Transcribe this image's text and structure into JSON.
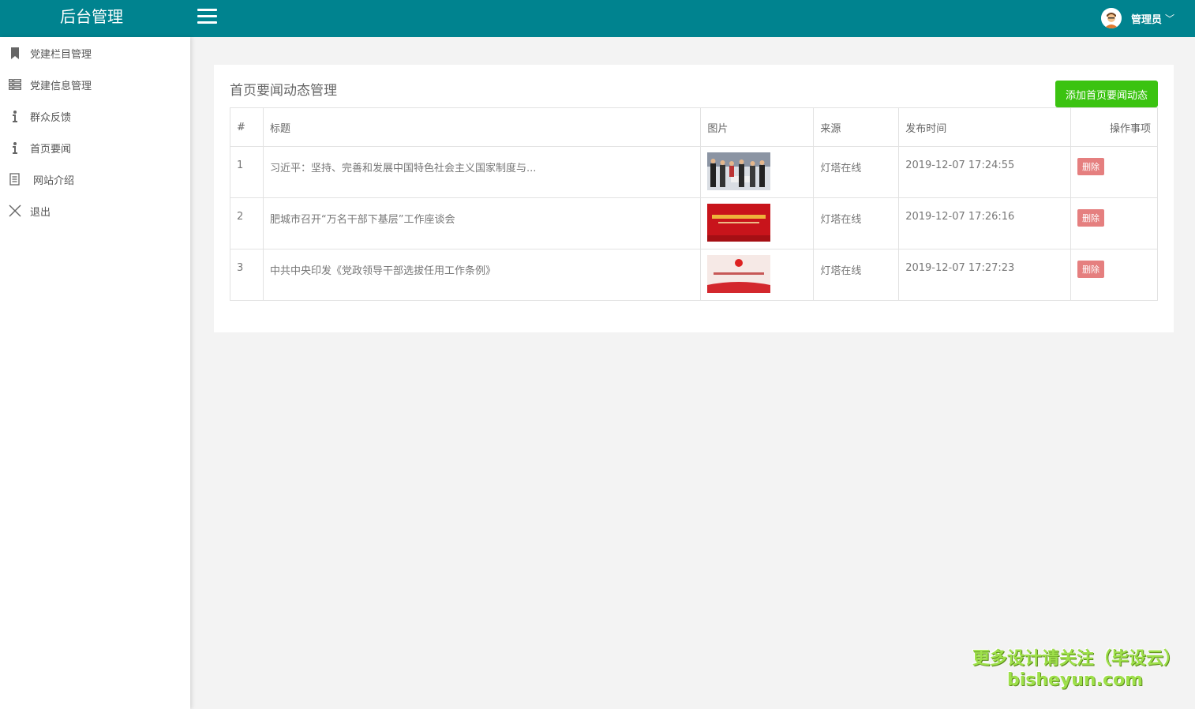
{
  "header": {
    "brand": "后台管理",
    "user_name": "管理员",
    "caret": "﹀"
  },
  "sidebar": {
    "items": [
      {
        "label": "党建栏目管理",
        "icon": "bookmark-icon"
      },
      {
        "label": "党建信息管理",
        "icon": "list-icon"
      },
      {
        "label": "群众反馈",
        "icon": "info-icon"
      },
      {
        "label": "首页要闻",
        "icon": "info-icon"
      },
      {
        "label": "网站介绍",
        "icon": "document-icon"
      },
      {
        "label": "退出",
        "icon": "close-icon"
      }
    ]
  },
  "main": {
    "title": "首页要闻动态管理",
    "add_label": "添加首页要闻动态",
    "columns": [
      "#",
      "标题",
      "图片",
      "来源",
      "发布时间",
      "操作事项"
    ],
    "rows": [
      {
        "num": "1",
        "title": "习近平：坚持、完善和发展中国特色社会主义国家制度与...",
        "source": "灯塔在线",
        "time": "2019-12-07 17:24:55",
        "action": "删除"
      },
      {
        "num": "2",
        "title": "肥城市召开“万名干部下基层”工作座谈会",
        "source": "灯塔在线",
        "time": "2019-12-07 17:26:16",
        "action": "删除"
      },
      {
        "num": "3",
        "title": "中共中央印发《党政领导干部选拔任用工作条例》",
        "source": "灯塔在线",
        "time": "2019-12-07 17:27:23",
        "action": "删除"
      }
    ]
  },
  "watermark": {
    "line1": "更多设计请关注（毕设云）",
    "line2": "bisheyun.com"
  },
  "colors": {
    "header_bg": "#00838f",
    "add_button": "#3bc311",
    "delete_button": "#e57f7f"
  }
}
